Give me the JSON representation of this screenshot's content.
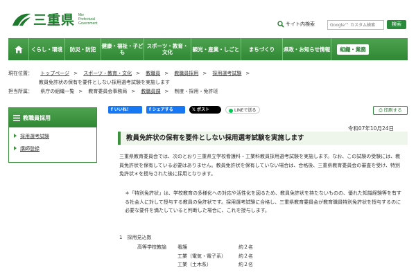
{
  "header": {
    "logo_text": "三重県",
    "logo_sub": [
      "Mie",
      "Prefectural",
      "Government"
    ],
    "site_search_label": "サイト内検索",
    "search_placeholder": "Google™ カスタム検索",
    "search_button": "検索"
  },
  "nav": [
    {
      "label": "くらし・環境"
    },
    {
      "label": "防災・防犯"
    },
    {
      "label": "健康・福祉・子ども"
    },
    {
      "label": "スポーツ・教育・文化"
    },
    {
      "label": "観光・産業・しごと"
    },
    {
      "label": "まちづくり"
    },
    {
      "label": "県政・お知らせ情報"
    },
    {
      "label": "組織・業務"
    }
  ],
  "breadcrumb": {
    "current_label": "現在位置：",
    "items": [
      "トップページ",
      "スポーツ・教育・文化",
      "教職員",
      "教職員採用",
      "採用選考試験"
    ],
    "current": "教員免許状の保有を要件としない採用選考試験を実施します",
    "org_label": "担当所属：",
    "org_items": [
      "県庁の組織一覧",
      "教育委員会事務局",
      "教職員課",
      "制度・採用・免許班"
    ]
  },
  "sidebar": {
    "heading": "教職員採用",
    "items": [
      "採用選考試験",
      "講師登録"
    ]
  },
  "share": {
    "fb_like": "いいね！",
    "fb_share": "シェアする",
    "x_post": "ポスト",
    "line": "LINEで送る",
    "print": "印刷する"
  },
  "article": {
    "date": "令和07年10月24日",
    "title": "教員免許状の保有を要件としない採用選考試験を実施します",
    "intro": "三重県教育委員会では、次のとおり三重県立学校看護科・工業科教員採用選考試験を実施します。なお、この試験の受験には、教員免許状を保有している必要はありません。教員免許状を保有していない場合は、合格後、三重県教育委員会の審査を受け、特別免許状＊を授与された後に採用となります。",
    "note": "＊「特別免許状」は、学校教育の多様化への対応や活性化を図るため、教員免許状を持たないものの、優れた知識経験等を有する社会人に対して授与する教員の免許状です。採用選考試験に合格し、三重県教育委員会が教育職員特別免許状を授与するのに必要な要件を満たしていると判断した場合に、これを授与します。",
    "section_title": "1　採用見込数",
    "rows": [
      {
        "cat": "高等学校教諭",
        "subject": "看護",
        "count": "約２名"
      },
      {
        "cat": "",
        "subject": "工業（電気・電子系）",
        "count": "約２名"
      },
      {
        "cat": "",
        "subject": "工業（土木系）",
        "count": "約２名"
      }
    ]
  },
  "colors": {
    "brand_green": "#2f8835",
    "light_green_bg": "#eef5ea",
    "facebook_blue": "#1877f2"
  }
}
